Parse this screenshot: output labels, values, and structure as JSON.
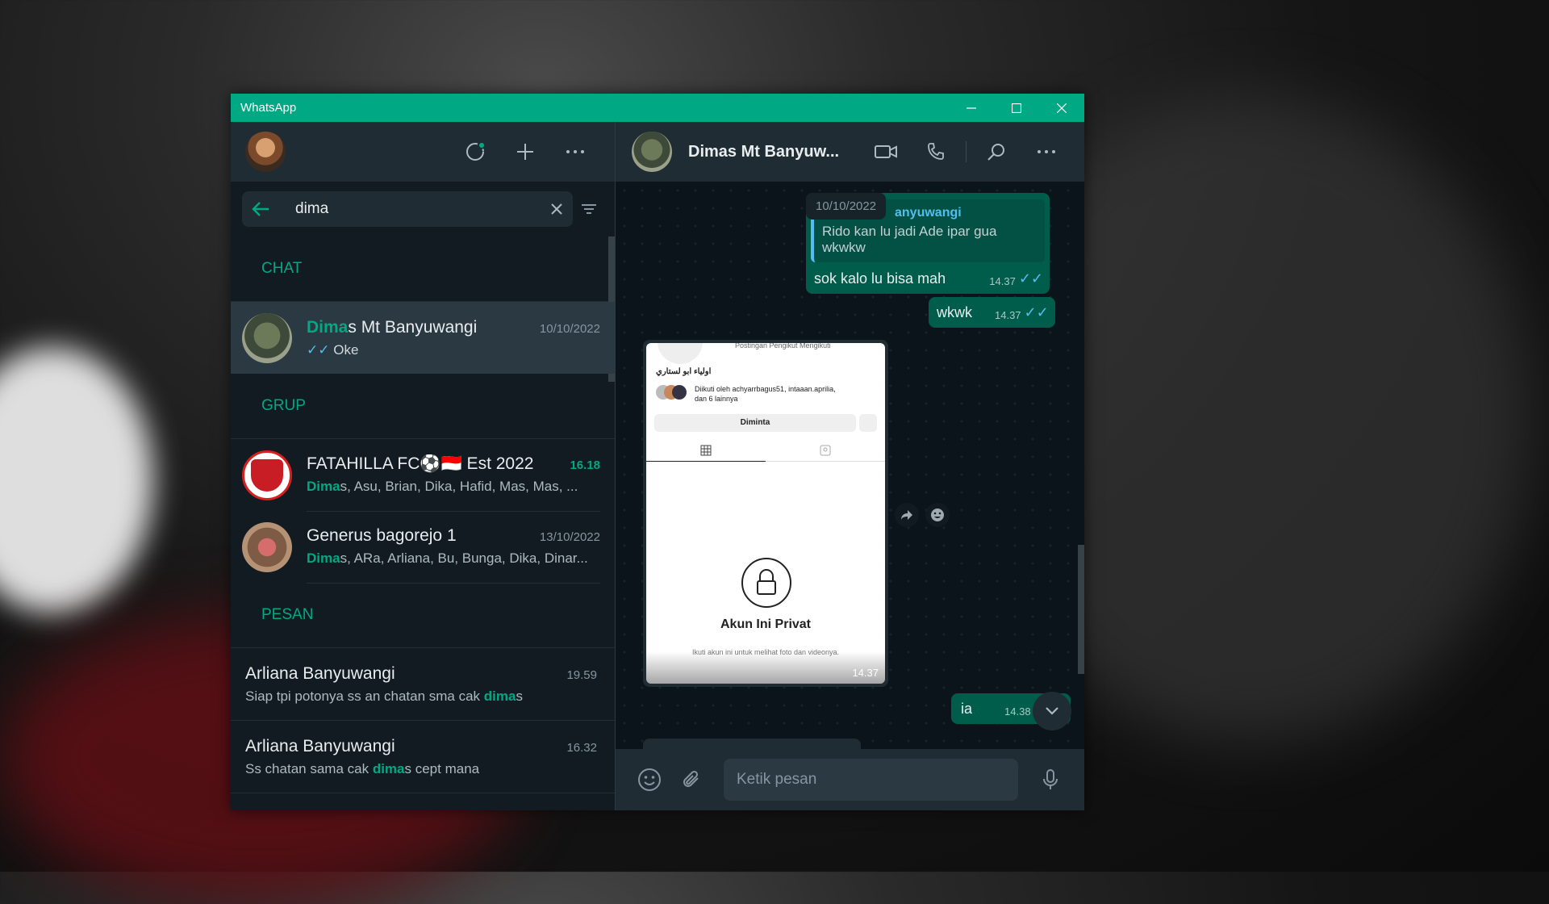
{
  "window": {
    "title": "WhatsApp"
  },
  "search": {
    "query": "dima",
    "placeholder": ""
  },
  "sections": {
    "chat": "CHAT",
    "group": "GRUP",
    "messages": "PESAN"
  },
  "chat_results": [
    {
      "name_hl": "Dima",
      "name_rest": "s Mt Banyuwangi",
      "time": "10/10/2022",
      "ticks": "✓✓",
      "preview": "Oke"
    }
  ],
  "group_results": [
    {
      "name": "FATAHILLA FC⚽🇮🇩 Est 2022",
      "time": "16.18",
      "members_hl": "Dima",
      "members_rest": "s, Asu, Brian, Dika, Hafid, Mas, Mas, ..."
    },
    {
      "name": "Generus bagorejo 1",
      "time": "13/10/2022",
      "members_hl": "Dima",
      "members_rest": "s, ARa, Arliana, Bu, Bunga, Dika, Dinar..."
    }
  ],
  "message_results": [
    {
      "name": "Arliana Banyuwangi",
      "time": "19.59",
      "pre": "Siap tpi potonya ss an chatan sma cak ",
      "hl": "dima",
      "post": "s"
    },
    {
      "name": "Arliana Banyuwangi",
      "time": "16.32",
      "pre": "Ss chatan sama cak ",
      "hl": "dima",
      "post": "s cept mana"
    }
  ],
  "conversation": {
    "contact_name": "Dimas Mt Banyuw...",
    "date_chip": "10/10/2022",
    "quoted": {
      "name": "anyuwangi",
      "text": "Rido kan lu jadi Ade ipar gua wkwkw"
    },
    "messages": [
      {
        "text": "sok kalo lu bisa mah",
        "time": "14.37",
        "ticks": "✓✓"
      },
      {
        "text": "wkwk",
        "time": "14.37",
        "ticks": "✓✓"
      },
      {
        "text": "ia",
        "time": "14.38",
        "ticks": "✓"
      }
    ],
    "image": {
      "top_labels": "Postingan   Pengikut   Mengikuti",
      "username": "اولياء ابو لستاري",
      "followed_by": "Diikuti oleh achyarrbagus51, intaaan.aprilia,",
      "followed_by_2": "dan 6 lainnya",
      "button": "Diminta",
      "private_title": "Akun Ini Privat",
      "private_sub": "Ikuti akun ini untuk melihat foto dan videonya.",
      "time": "14.37"
    }
  },
  "composer": {
    "placeholder": "Ketik pesan"
  },
  "colors": {
    "accent": "#00a884",
    "bubble_out": "#005c4b",
    "panel": "#202c33",
    "background": "#111b21"
  }
}
